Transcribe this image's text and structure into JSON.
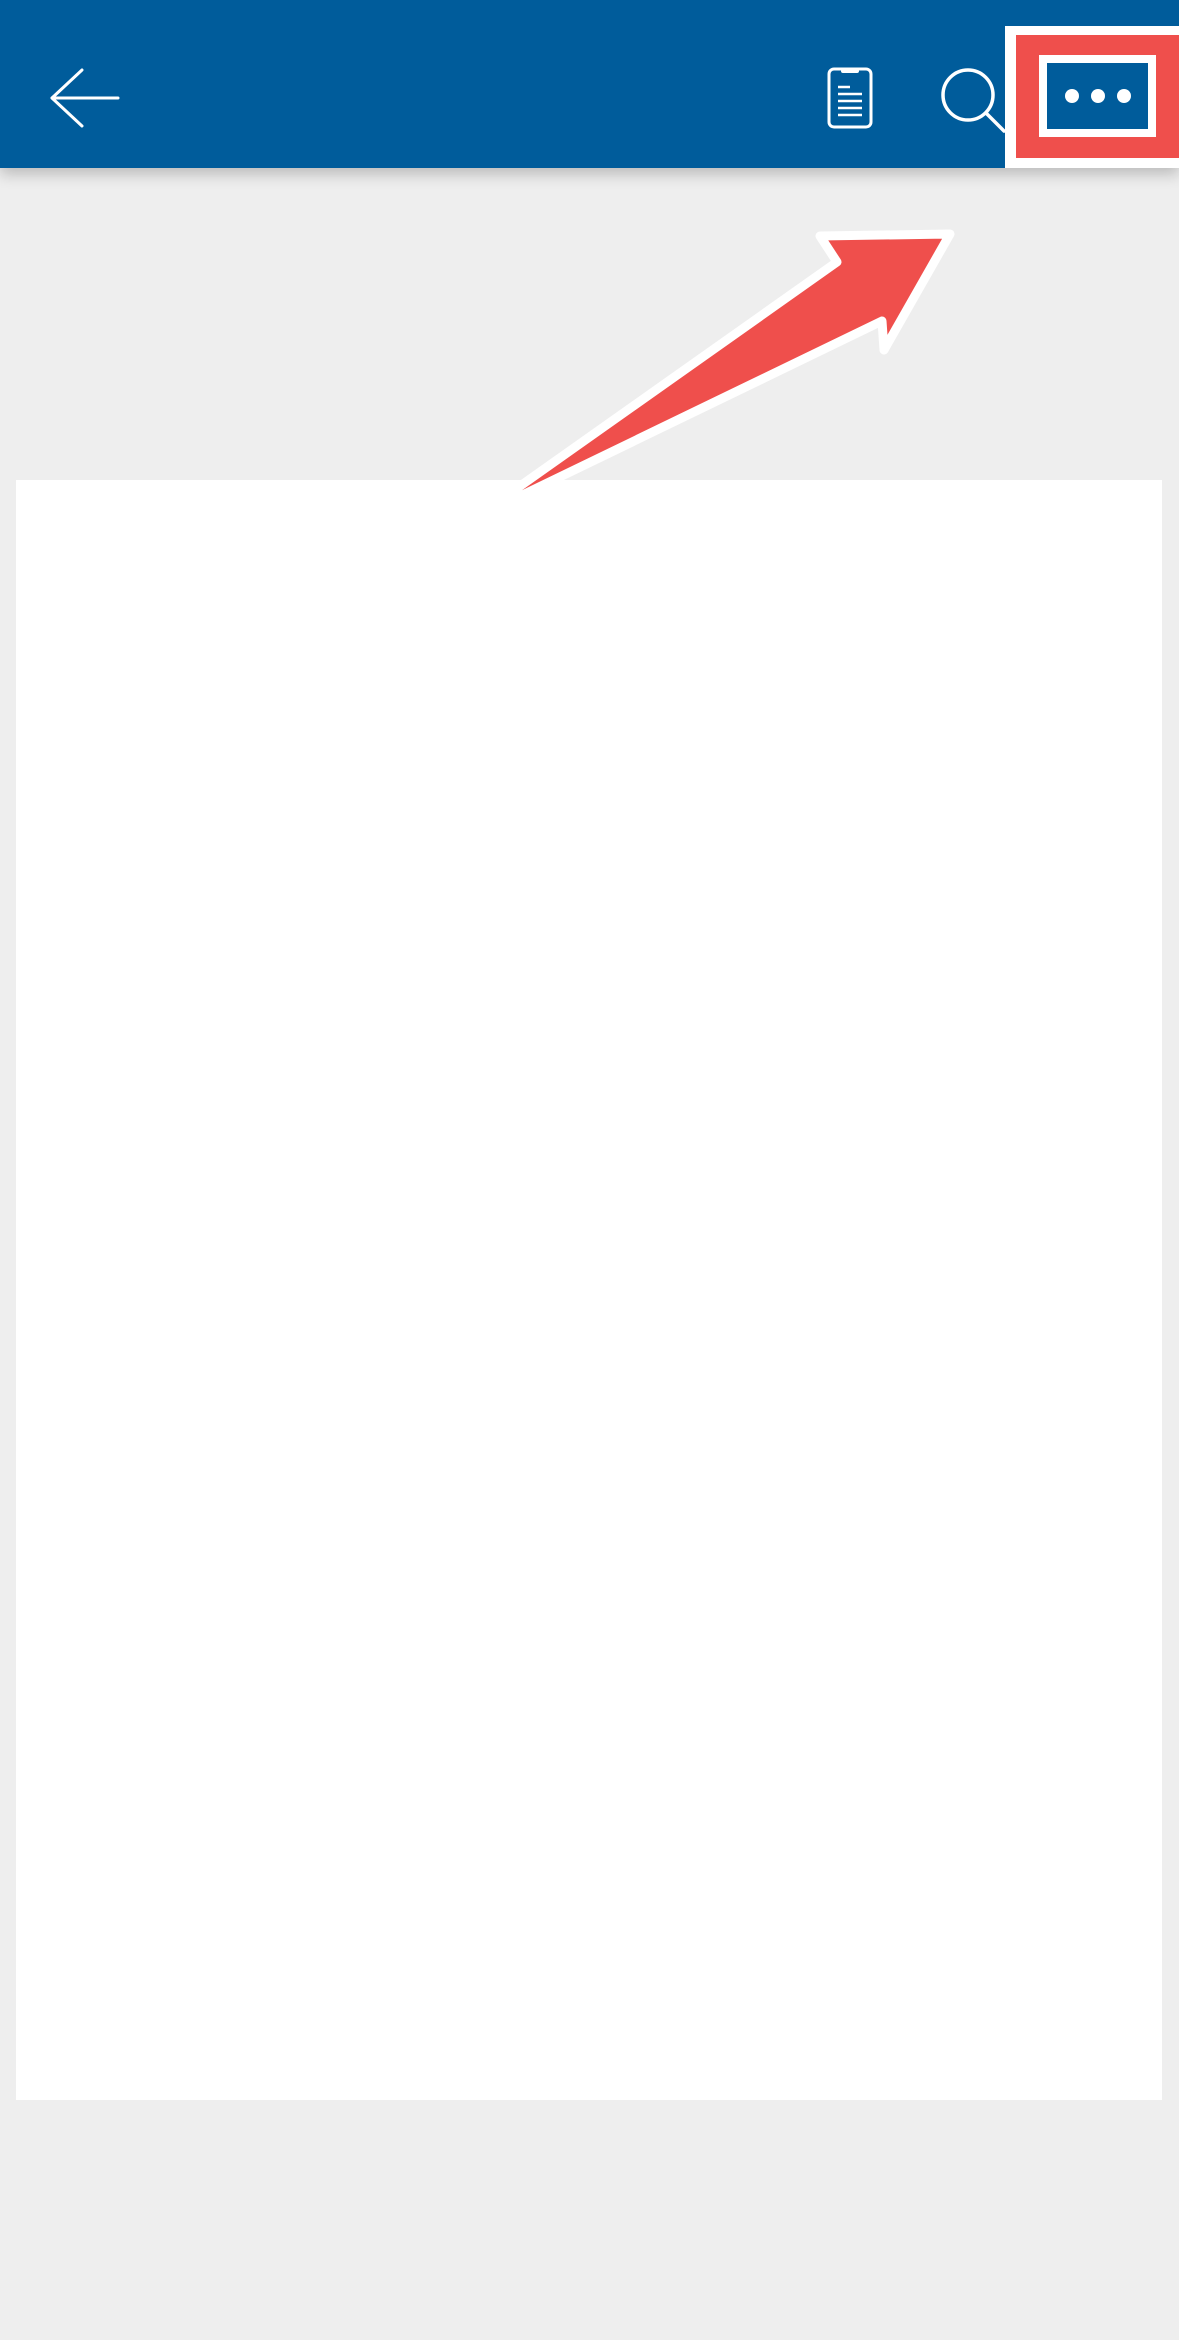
{
  "colors": {
    "app_bar": "#005c9b",
    "highlight": "#ef4f4c",
    "background": "#eeeeee",
    "page": "#ffffff",
    "icon": "#ffffff"
  },
  "app_bar": {
    "icons": {
      "back": "arrow-left-icon",
      "reading_view": "phone-document-icon",
      "search": "search-icon",
      "more": "more-options-icon"
    }
  },
  "annotation": {
    "highlight_target": "more-options-button",
    "pointer": "red-arrow"
  }
}
